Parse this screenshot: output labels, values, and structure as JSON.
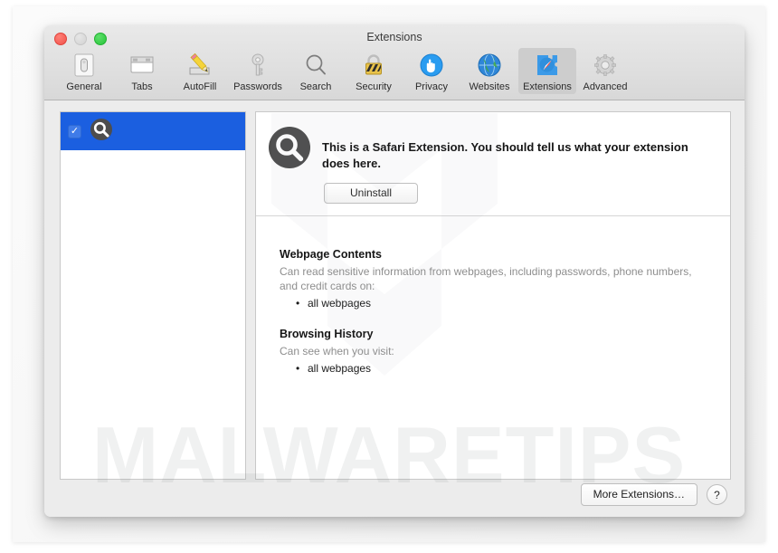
{
  "window": {
    "title": "Extensions",
    "traffic_lights": [
      {
        "name": "close",
        "color": "#f0524b"
      },
      {
        "name": "minimize",
        "color": "#d2d2d2"
      },
      {
        "name": "zoom",
        "color": "#27c43a"
      }
    ]
  },
  "toolbar": {
    "items": [
      {
        "label": "General",
        "icon": "general-icon",
        "selected": false
      },
      {
        "label": "Tabs",
        "icon": "tabs-icon",
        "selected": false
      },
      {
        "label": "AutoFill",
        "icon": "autofill-icon",
        "selected": false
      },
      {
        "label": "Passwords",
        "icon": "passwords-icon",
        "selected": false
      },
      {
        "label": "Search",
        "icon": "search-icon",
        "selected": false
      },
      {
        "label": "Security",
        "icon": "security-icon",
        "selected": false
      },
      {
        "label": "Privacy",
        "icon": "privacy-icon",
        "selected": false
      },
      {
        "label": "Websites",
        "icon": "websites-icon",
        "selected": false
      },
      {
        "label": "Extensions",
        "icon": "extensions-icon",
        "selected": true
      },
      {
        "label": "Advanced",
        "icon": "advanced-icon",
        "selected": false
      }
    ]
  },
  "sidebar": {
    "items": [
      {
        "name": "",
        "icon": "magnifier-extension-icon",
        "enabled": true,
        "checkmark": "✓",
        "selected": true,
        "highlight_color": "#1b5fe0"
      }
    ]
  },
  "detail": {
    "icon": "magnifier-extension-icon",
    "description": "This is a Safari Extension. You should tell us what your extension does here.",
    "uninstall_label": "Uninstall",
    "permissions": [
      {
        "title": "Webpage Contents",
        "description": "Can read sensitive information from webpages, including passwords, phone numbers, and credit cards on:",
        "items": [
          "all webpages"
        ]
      },
      {
        "title": "Browsing History",
        "description": "Can see when you visit:",
        "items": [
          "all webpages"
        ]
      }
    ]
  },
  "footer": {
    "more_extensions_label": "More Extensions…",
    "help_label": "?"
  },
  "watermark": {
    "text": "MALWARETIPS",
    "logo": "chevron-shield-logo"
  }
}
